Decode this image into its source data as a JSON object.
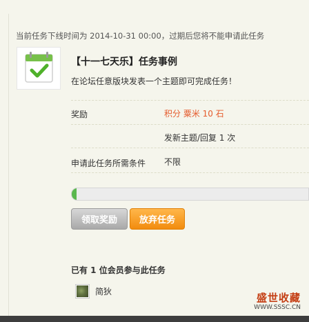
{
  "task": {
    "deadline_text": "当前任务下线时间为 2014-10-31 00:00，过期后您将不能申请此任务",
    "title": "【十一七天乐】任务事例",
    "description": "在论坛任意版块发表一个主题即可完成任务！",
    "reward_label": "奖励",
    "reward_value": "积分 粟米 10 石",
    "requirement": "发新主题/回复 1 次",
    "condition_label": "申请此任务所需条件",
    "condition_value": "不限",
    "progress_fraction": 0.02
  },
  "buttons": {
    "claim_reward": "领取奖励",
    "abandon_task": "放弃任务"
  },
  "participants": {
    "summary": "已有 1 位会员参与此任务",
    "members": [
      {
        "name": "简狄"
      }
    ]
  },
  "watermark": {
    "text": "盛世收藏",
    "url": "WWW.SSSC.CN"
  },
  "colors": {
    "reward": "#e55b2c",
    "progress": "#5ab84e",
    "abandon_button": "#f5981d"
  },
  "icons": {
    "task_icon": "calendar-check-icon"
  }
}
